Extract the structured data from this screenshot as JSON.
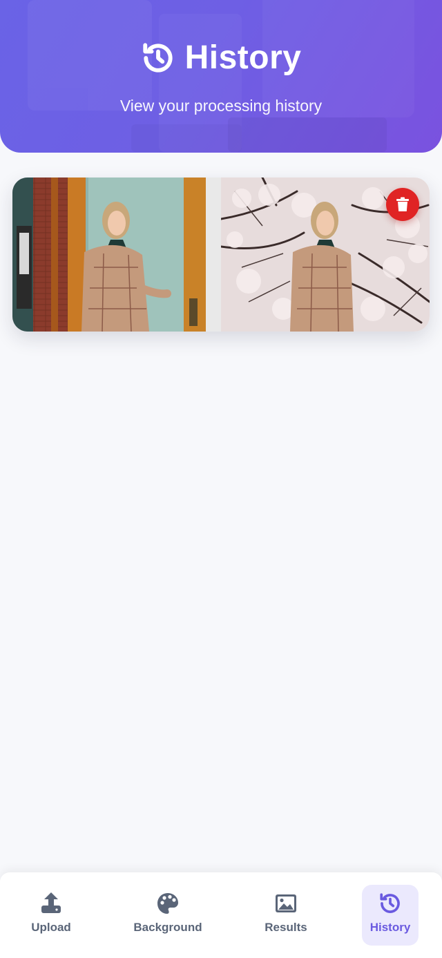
{
  "header": {
    "title": "History",
    "subtitle": "View your processing history",
    "title_icon": "history-icon"
  },
  "history": {
    "items": [
      {
        "original_alt": "original photo",
        "result_alt": "processed photo with cherry blossom background",
        "delete_icon": "trash-icon"
      }
    ]
  },
  "nav": {
    "items": [
      {
        "label": "Upload",
        "icon": "upload-icon",
        "active": false
      },
      {
        "label": "Background",
        "icon": "palette-icon",
        "active": false
      },
      {
        "label": "Results",
        "icon": "image-icon",
        "active": false
      },
      {
        "label": "History",
        "icon": "history-icon",
        "active": true
      }
    ]
  },
  "colors": {
    "accent": "#6a5ae0",
    "header_start": "#6a63e6",
    "header_end": "#7a52df",
    "delete": "#e02424",
    "nav_text": "#5a6578",
    "background": "#f7f8fb"
  }
}
